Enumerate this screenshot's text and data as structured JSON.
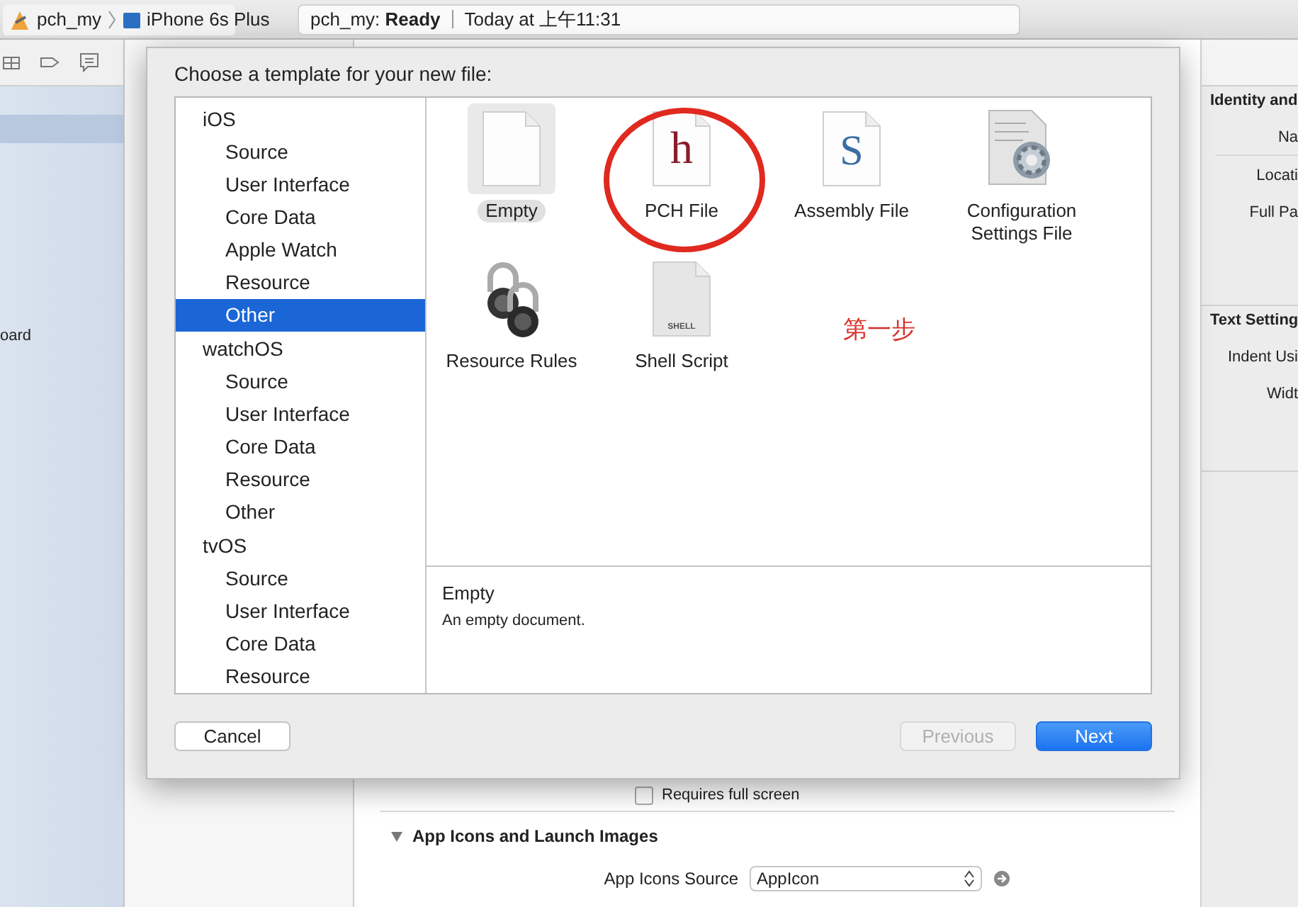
{
  "toolbar": {
    "scheme": "pch_my",
    "device": "iPhone 6s Plus",
    "status": "pch_my: **Ready**",
    "timestamp": "Today at 上午11:31"
  },
  "navigator": {
    "item_label": "oard"
  },
  "editor": {
    "checkbox": {
      "label": "Requires full screen",
      "checked": false
    },
    "section": {
      "title": "App Icons and Launch Images",
      "expanded": true
    },
    "field": {
      "label": "App Icons Source",
      "value": "AppIcon"
    }
  },
  "inspector": {
    "sections": [
      {
        "title": "Identity and",
        "labels": [
          "Na",
          "Locati",
          "Full Pa"
        ]
      },
      {
        "title": "Text Setting",
        "labels": [
          "Indent Usi",
          "Widt"
        ]
      }
    ]
  },
  "sheet": {
    "title": "Choose a template for your new file:",
    "categories": [
      {
        "label": "iOS",
        "children": [
          {
            "label": "Source",
            "selected": false
          },
          {
            "label": "User Interface",
            "selected": false
          },
          {
            "label": "Core Data",
            "selected": false
          },
          {
            "label": "Apple Watch",
            "selected": false
          },
          {
            "label": "Resource",
            "selected": false
          },
          {
            "label": "Other",
            "selected": true
          }
        ]
      },
      {
        "label": "watchOS",
        "children": [
          {
            "label": "Source",
            "selected": false
          },
          {
            "label": "User Interface",
            "selected": false
          },
          {
            "label": "Core Data",
            "selected": false
          },
          {
            "label": "Resource",
            "selected": false
          },
          {
            "label": "Other",
            "selected": false
          }
        ]
      },
      {
        "label": "tvOS",
        "children": [
          {
            "label": "Source",
            "selected": false
          },
          {
            "label": "User Interface",
            "selected": false
          },
          {
            "label": "Core Data",
            "selected": false
          },
          {
            "label": "Resource",
            "selected": false
          }
        ]
      }
    ],
    "templates": [
      {
        "label": "Empty",
        "kind": "document",
        "selected": true
      },
      {
        "label": "PCH File",
        "kind": "document",
        "glyph": "h",
        "selected": false
      },
      {
        "label": "Assembly File",
        "kind": "document",
        "glyph": "S",
        "selected": false
      },
      {
        "label": "Configuration Settings File",
        "kind": "config",
        "selected": false
      },
      {
        "label": "Resource Rules",
        "kind": "lock",
        "selected": false
      },
      {
        "label": "Shell Script",
        "kind": "shell",
        "glyph": "SHELL",
        "selected": false
      }
    ],
    "annotation": "第一步",
    "description": {
      "title": "Empty",
      "text": "An empty document."
    },
    "buttons": [
      {
        "label": "Cancel",
        "kind": "normal",
        "disabled": false
      },
      {
        "label": "Previous",
        "kind": "normal",
        "disabled": true
      },
      {
        "label": "Next",
        "kind": "default",
        "disabled": false
      }
    ]
  }
}
